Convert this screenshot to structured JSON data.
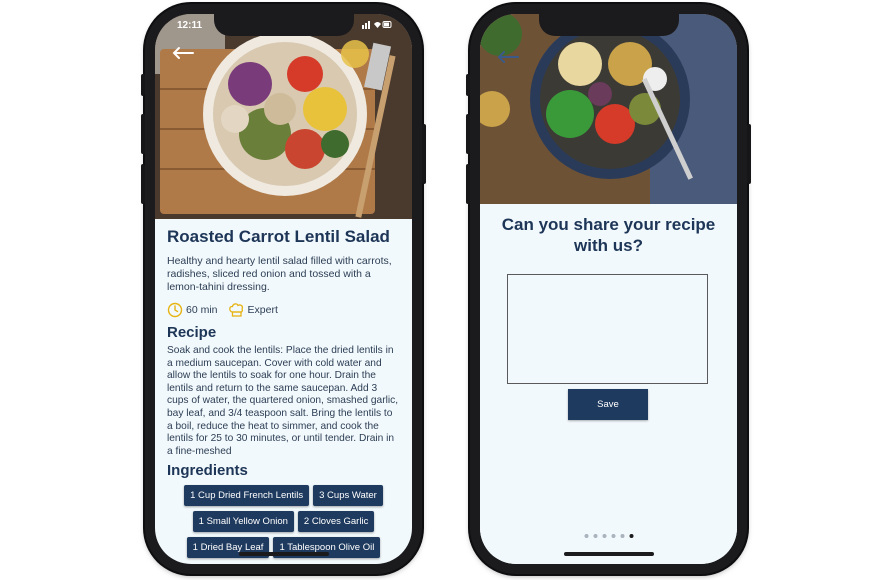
{
  "left_screen": {
    "status_time": "12:11",
    "title": "Roasted Carrot Lentil Salad",
    "description": "Healthy and hearty lentil salad filled with carrots, radishes, sliced red onion and tossed with a lemon-tahini dressing.",
    "time": "60 min",
    "difficulty": "Expert",
    "recipe_heading": "Recipe",
    "recipe_text": "Soak and cook the lentils: Place the dried lentils in a medium saucepan. Cover with cold water and allow the lentils to soak for one hour. Drain the lentils and return to the same saucepan. Add 3 cups of water, the quartered onion, smashed garlic, bay leaf, and 3/4 teaspoon salt. Bring the lentils to a boil, reduce the heat to simmer, and cook the lentils for 25 to 30 minutes, or until tender. Drain in a fine-meshed",
    "ingredients_heading": "Ingredients",
    "ingredients": [
      "1 Cup Dried French Lentils",
      "3 Cups Water",
      "1 Small Yellow Onion",
      "2 Cloves Garlic",
      "1 Dried Bay Leaf",
      "1 Tablespoon Olive Oil"
    ],
    "icons": {
      "back": "back-arrow-icon",
      "time": "clock-icon",
      "difficulty": "chef-hat-icon"
    }
  },
  "right_screen": {
    "question": "Can you share your recipe with us?",
    "input_value": "",
    "save_label": "Save",
    "page_count": 6,
    "active_page": 6
  },
  "colors": {
    "primary": "#1e3a5f",
    "heading": "#1d3557",
    "screen_bg": "#f2f9fc",
    "accent_icon": "#e7b416",
    "phone_frame": "#1b1b1d"
  }
}
